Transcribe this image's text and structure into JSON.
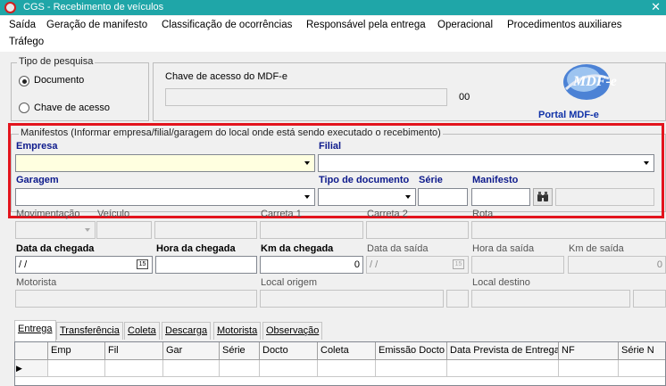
{
  "window": {
    "title": "CGS - Recebimento de veículos",
    "close_glyph": "✕"
  },
  "menu": [
    "Saída",
    "Geração de manifesto",
    "Classificação de ocorrências",
    "Responsável pela entrega",
    "Operacional",
    "Procedimentos auxiliares",
    "Tráfego"
  ],
  "search_type": {
    "legend": "Tipo de pesquisa",
    "option_document": "Documento",
    "option_key": "Chave de acesso",
    "selected": "Documento"
  },
  "access_key": {
    "label": "Chave de acesso do MDF-e",
    "value": "",
    "suffix": "00"
  },
  "logo": {
    "text": "Portal MDF-e",
    "mark": "MDF-e"
  },
  "manifests": {
    "legend": "Manifestos (Informar empresa/filial/garagem do local onde está sendo executado o recebimento)",
    "empresa_label": "Empresa",
    "empresa_value": "",
    "filial_label": "Filial",
    "filial_value": "",
    "garagem_label": "Garagem",
    "garagem_value": "",
    "tipo_doc_label": "Tipo de documento",
    "serie_label": "Série",
    "manifesto_label": "Manifesto"
  },
  "movement": {
    "movimentacao_label": "Movimentação",
    "veiculo_label": "Veículo",
    "carreta1_label": "Carreta 1",
    "carreta2_label": "Carreta 2",
    "rota_label": "Rota"
  },
  "arrival": {
    "data_chegada_label": "Data da chegada",
    "data_chegada_value": " / /",
    "hora_chegada_label": "Hora da chegada",
    "hora_chegada_value": "",
    "km_chegada_label": "Km da chegada",
    "km_chegada_value": "0",
    "data_saida_label": "Data da saída",
    "data_saida_value": " / /",
    "hora_saida_label": "Hora da saída",
    "km_saida_label": "Km de saída",
    "km_saida_value": "0",
    "calendar_glyph": "15"
  },
  "people": {
    "motorista_label": "Motorista",
    "origem_label": "Local origem",
    "destino_label": "Local destino"
  },
  "tabs": [
    "Entrega",
    "Transferência",
    "Coleta",
    "Descarga",
    "Motorista",
    "Observação"
  ],
  "grid": {
    "columns": [
      "Emp",
      "Fil",
      "Gar",
      "Série",
      "Docto",
      "Coleta",
      "Emissão Docto",
      "Data Prevista de Entrega",
      "NF",
      "Série N"
    ],
    "row_indicator": "▶"
  },
  "colors": {
    "title_bar": "#1fa6a8",
    "highlight": "#e3141d",
    "bold_label": "#0d1a8c",
    "required_field": "#ffffe0"
  },
  "icons": [
    "app-logo-icon",
    "close-icon",
    "dropdown-arrow-icon",
    "calendar-icon",
    "binoculars-icon",
    "row-pointer-icon"
  ]
}
